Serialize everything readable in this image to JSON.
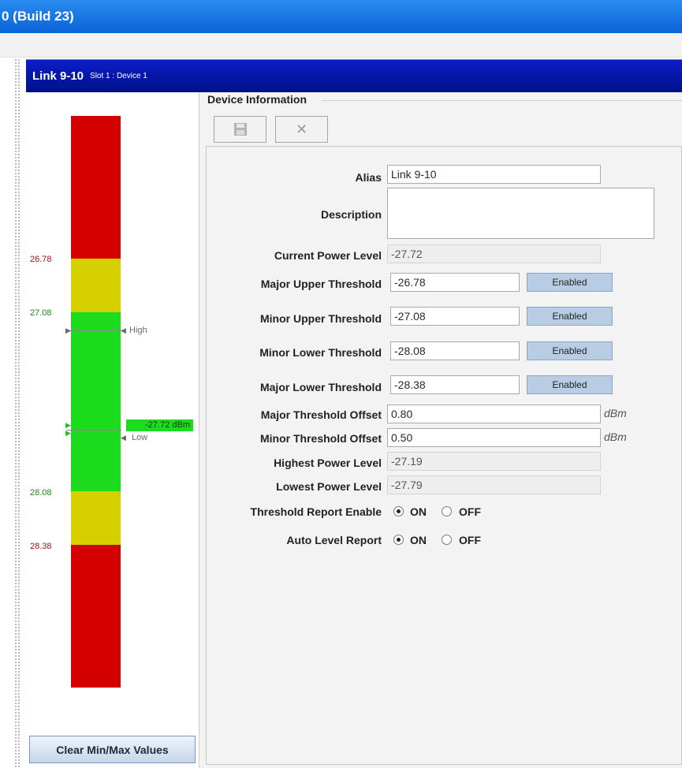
{
  "window": {
    "title": "0 (Build 23)"
  },
  "panel": {
    "title": "Link 9-10",
    "subtitle": "Slot 1 : Device 1"
  },
  "meter": {
    "labels": {
      "major_upper": "26.78",
      "minor_upper": "27.08",
      "minor_lower": "28.08",
      "major_lower": "28.38"
    },
    "high_marker": "High",
    "low_marker": "Low",
    "current_value": "-27.72 dBm",
    "colors": {
      "red": "#d40000",
      "yellow": "#d6d000",
      "green": "#1ddc1d"
    }
  },
  "buttons": {
    "clear_minmax": "Clear Min/Max Values"
  },
  "device_info": {
    "group_title": "Device Information",
    "toolbar": {
      "save_icon": "save-icon",
      "cancel_icon": "close-icon"
    },
    "fields": {
      "alias_label": "Alias",
      "alias_value": "Link 9-10",
      "description_label": "Description",
      "description_value": "",
      "current_power_label": "Current Power Level",
      "current_power_value": "-27.72",
      "major_upper_label": "Major Upper Threshold",
      "major_upper_value": "-26.78",
      "major_upper_state": "Enabled",
      "minor_upper_label": "Minor Upper Threshold",
      "minor_upper_value": "-27.08",
      "minor_upper_state": "Enabled",
      "minor_lower_label": "Minor Lower Threshold",
      "minor_lower_value": "-28.08",
      "minor_lower_state": "Enabled",
      "major_lower_label": "Major Lower Threshold",
      "major_lower_value": "-28.38",
      "major_lower_state": "Enabled",
      "major_offset_label": "Major Threshold Offset",
      "major_offset_value": "0.80",
      "major_offset_unit": "dBm",
      "minor_offset_label": "Minor Threshold Offset",
      "minor_offset_value": "0.50",
      "minor_offset_unit": "dBm",
      "highest_label": "Highest Power Level",
      "highest_value": "-27.19",
      "lowest_label": "Lowest Power Level",
      "lowest_value": "-27.79",
      "threshold_report_label": "Threshold Report Enable",
      "auto_level_label": "Auto Level Report",
      "on_label": "ON",
      "off_label": "OFF"
    }
  }
}
